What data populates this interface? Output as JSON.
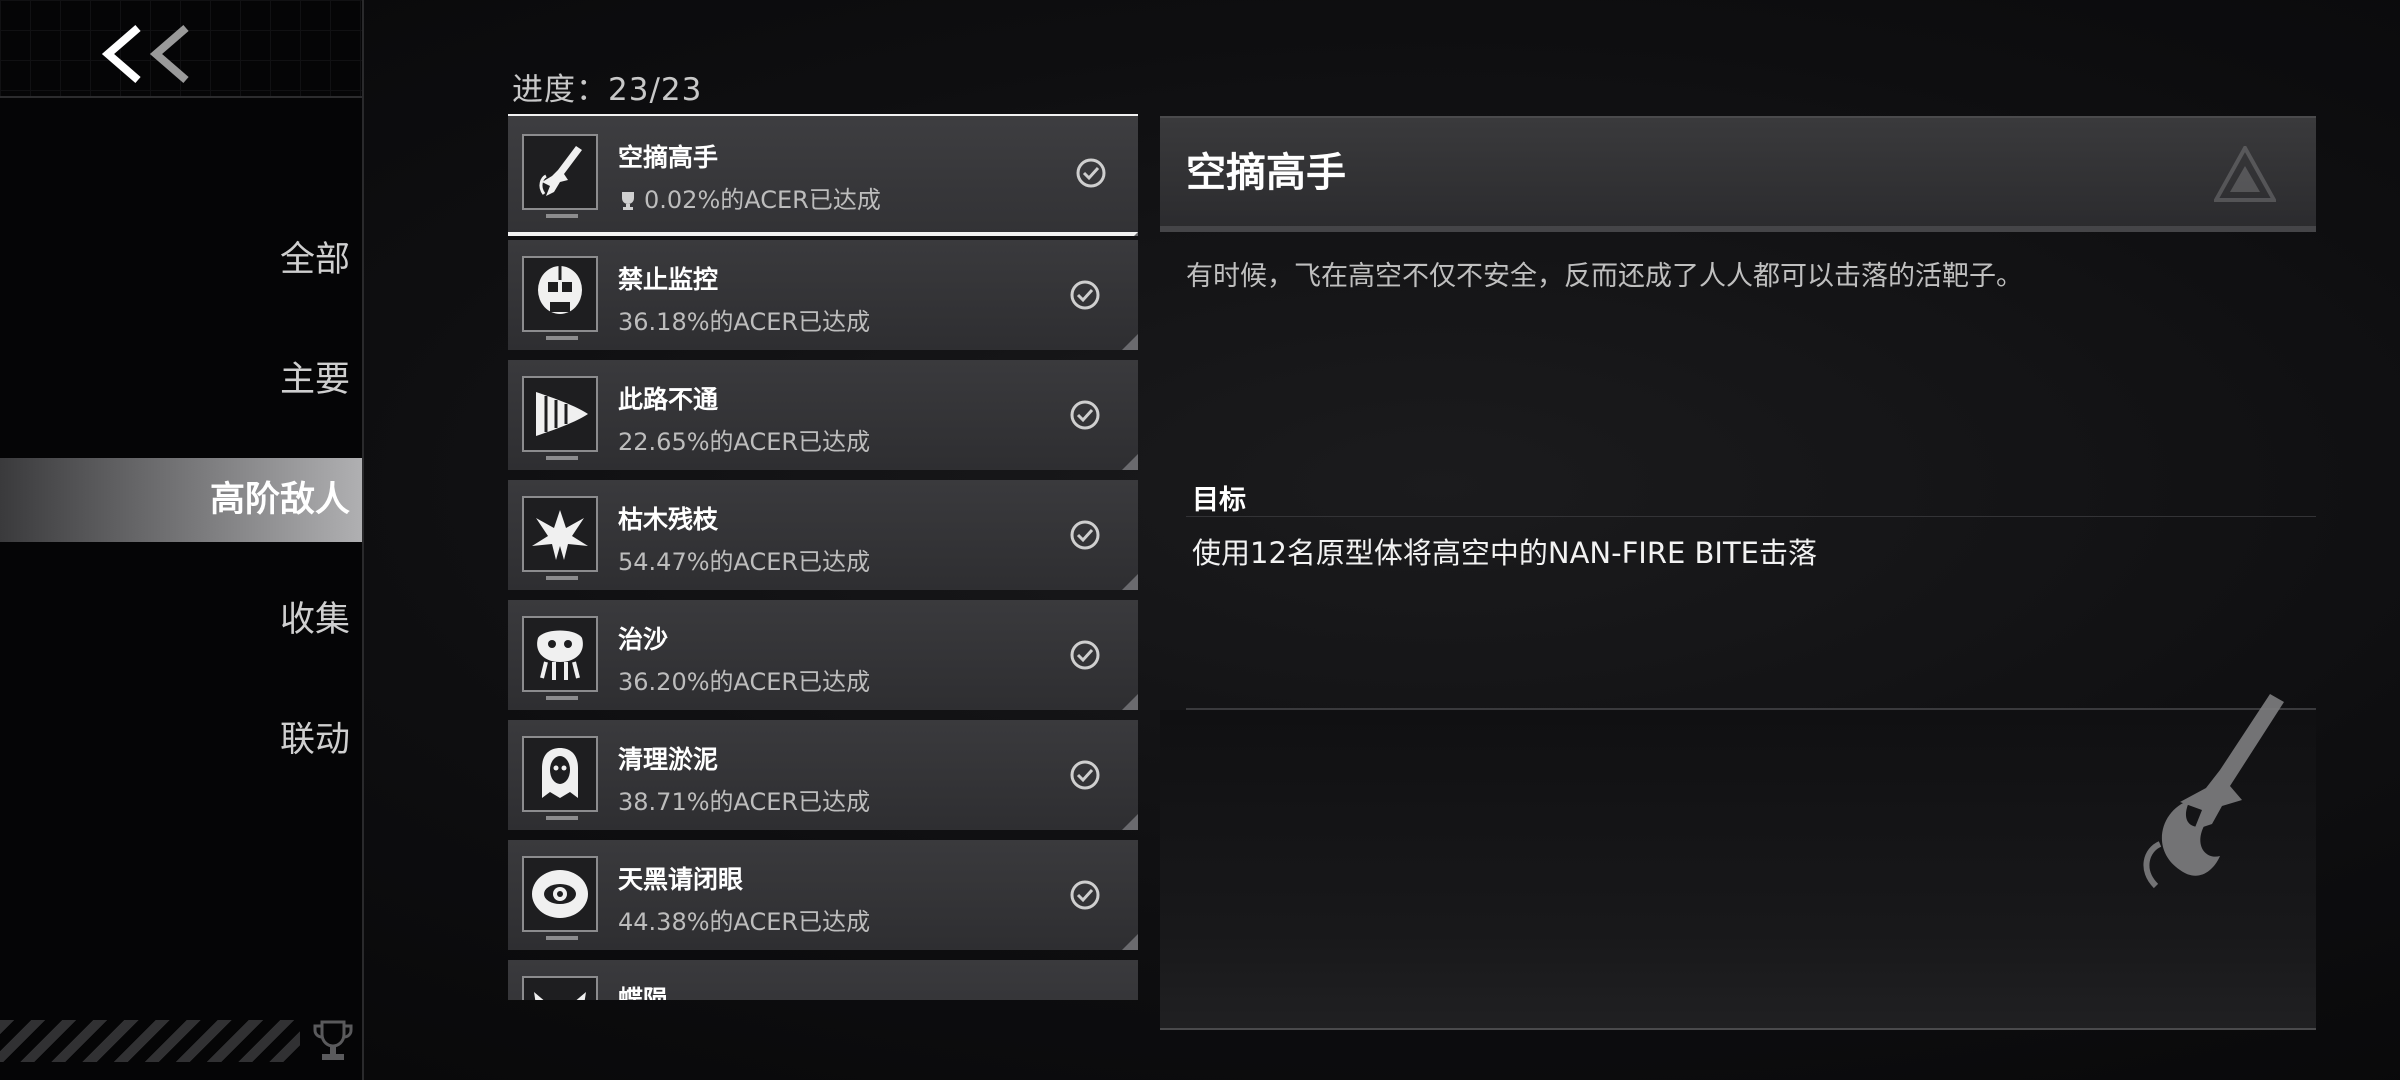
{
  "nav": {
    "back_icon": "double-chevron-left-icon",
    "items": [
      {
        "label": "全部",
        "active": false
      },
      {
        "label": "主要",
        "active": false
      },
      {
        "label": "高阶敌人",
        "active": true
      },
      {
        "label": "收集",
        "active": false
      },
      {
        "label": "联动",
        "active": false
      }
    ]
  },
  "progress": {
    "label": "进度：23/23"
  },
  "achievements": [
    {
      "name": "空摘高手",
      "rate": "0.02%的ACER已达成",
      "icon": "sword-flame-icon",
      "selected": true
    },
    {
      "name": "禁止监控",
      "rate": "36.18%的ACER已达成",
      "icon": "robot-skull-icon"
    },
    {
      "name": "此路不通",
      "rate": "22.65%的ACER已达成",
      "icon": "drill-icon"
    },
    {
      "name": "枯木残枝",
      "rate": "54.47%的ACER已达成",
      "icon": "thorn-creature-icon"
    },
    {
      "name": "治沙",
      "rate": "36.20%的ACER已达成",
      "icon": "sand-worm-icon"
    },
    {
      "name": "清理淤泥",
      "rate": "38.71%的ACER已达成",
      "icon": "ghost-mask-icon"
    },
    {
      "name": "天黑请闭眼",
      "rate": "44.38%的ACER已达成",
      "icon": "eye-icon"
    },
    {
      "name": "蝶陨",
      "rate": "",
      "icon": "butterfly-icon"
    }
  ],
  "detail": {
    "title": "空摘高手",
    "description": "有时候，飞在高空不仅不安全，反而还成了人人都可以击落的活靶子。",
    "goal_label": "目标",
    "goal_text": "使用12名原型体将高空中的NAN-FIRE BITE击落",
    "big_icon": "sword-flame-icon"
  }
}
